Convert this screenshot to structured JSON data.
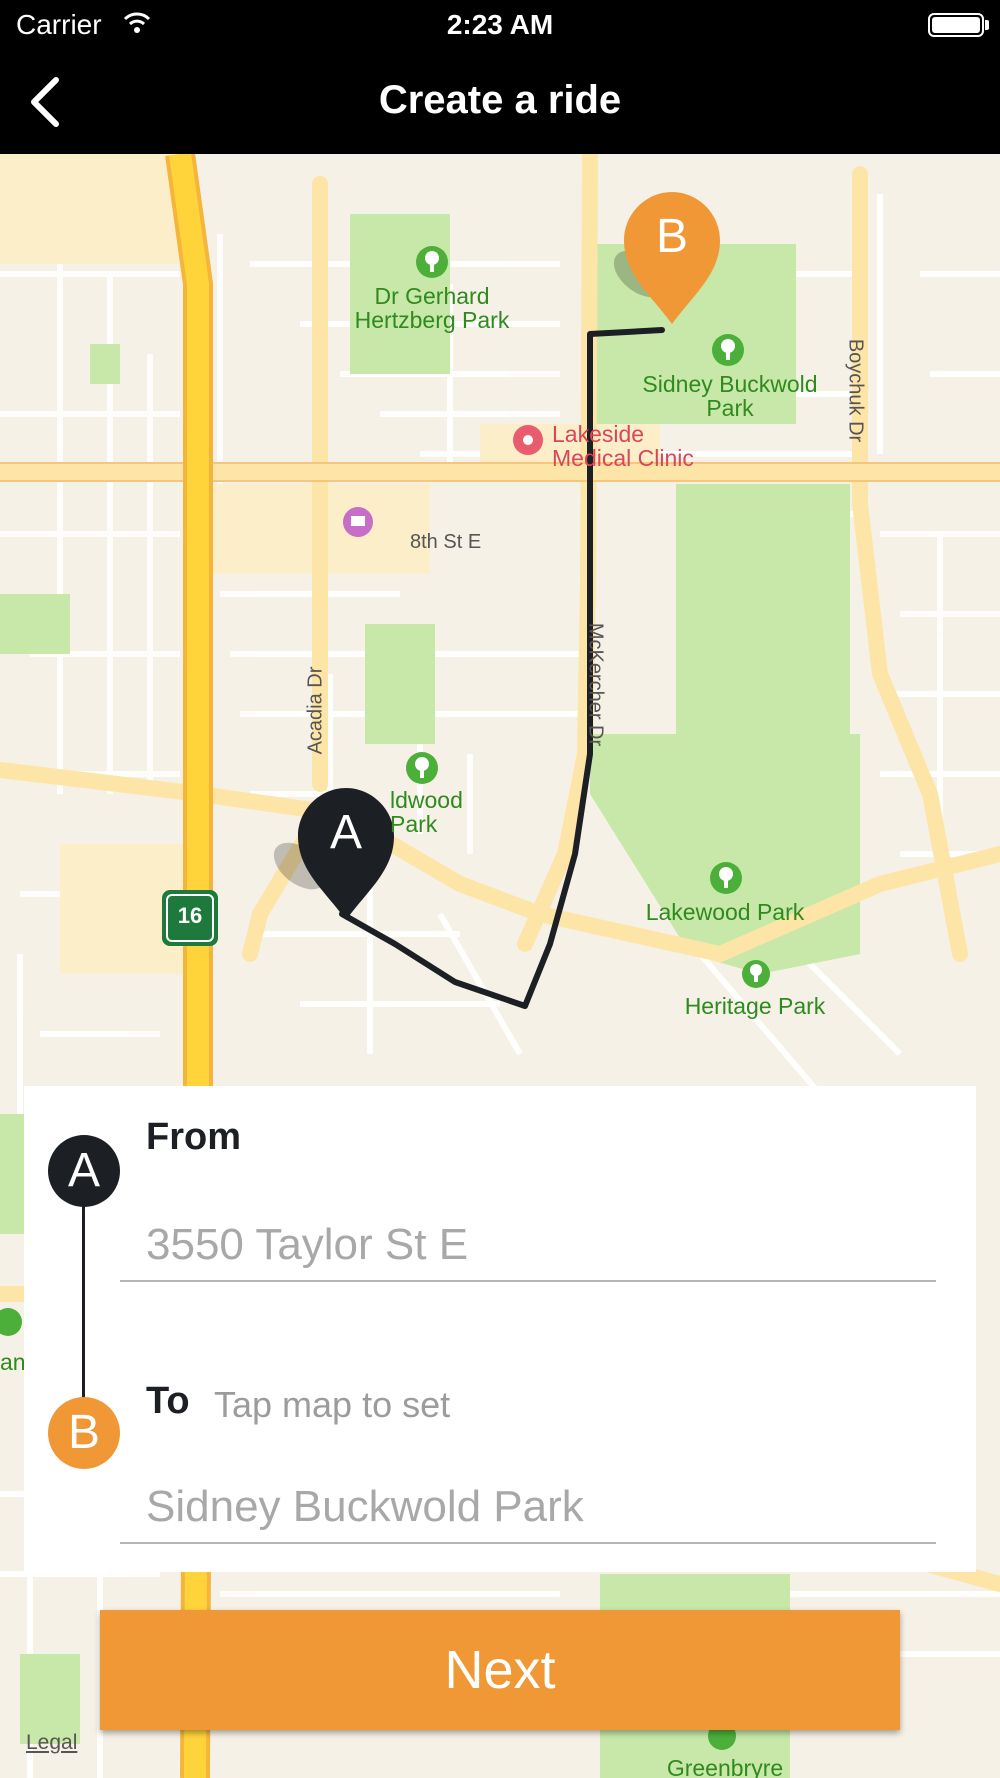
{
  "status_bar": {
    "carrier": "Carrier",
    "time": "2:23 AM",
    "wifi_icon": "wifi-icon",
    "battery_icon": "battery-icon"
  },
  "nav": {
    "title": "Create a ride",
    "back_icon": "chevron-left-icon"
  },
  "map": {
    "labels": {
      "park_gerhard": "Dr Gerhard Hertzberg Park",
      "park_sidney": "Sidney Buckwold Park",
      "clinic": "Lakeside Medical Clinic",
      "street_8th": "8th St E",
      "street_acadia": "Acadia Dr",
      "street_mckercher": "McKercher Dr",
      "street_boychuk": "Boychuk Dr",
      "park_wildwood": "ldwood Park",
      "park_lakewood": "Lakewood Park",
      "park_heritage": "Heritage Park",
      "park_greenbryre": "Greenbryre",
      "park_left_partial": "an",
      "highway_number": "16"
    },
    "pins": {
      "origin": "A",
      "destination": "B"
    },
    "legal": "Legal",
    "colors": {
      "route": "#1c1f24",
      "destination_pin": "#f09836",
      "origin_pin": "#1c1f24",
      "park": "#c7e8a8",
      "highway": "#ffd43a",
      "major_road": "#fde8b0"
    }
  },
  "form": {
    "from_badge": "A",
    "from_label": "From",
    "from_placeholder": "3550 Taylor St E",
    "to_badge": "B",
    "to_label": "To",
    "to_hint": "Tap map to set",
    "to_placeholder": "Sidney Buckwold Park"
  },
  "next_button": "Next"
}
